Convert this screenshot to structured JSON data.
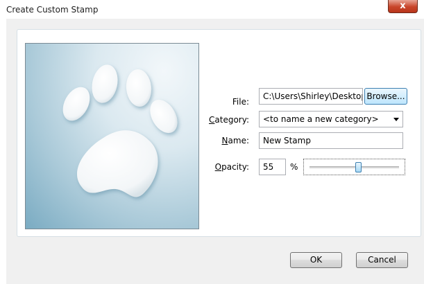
{
  "window": {
    "title": "Create Custom Stamp",
    "close_glyph": "x"
  },
  "preview": {
    "image": "paw-print-icon"
  },
  "form": {
    "file": {
      "label": "File:",
      "value": "C:\\Users\\Shirley\\Desktop",
      "browse_label": "Browse..."
    },
    "category": {
      "label_pre": "",
      "label_accel": "C",
      "label_post": "ategory:",
      "value": "<to name a new category>"
    },
    "name": {
      "label_pre": "",
      "label_accel": "N",
      "label_post": "ame:",
      "value": "New Stamp"
    },
    "opacity": {
      "label_pre": "",
      "label_accel": "O",
      "label_post": "pacity:",
      "value": "55",
      "unit": "%",
      "slider_fraction": 0.55
    }
  },
  "buttons": {
    "ok": "OK",
    "cancel": "Cancel"
  },
  "colors": {
    "accent": "#3c7fb1",
    "close": "#c8452a"
  }
}
